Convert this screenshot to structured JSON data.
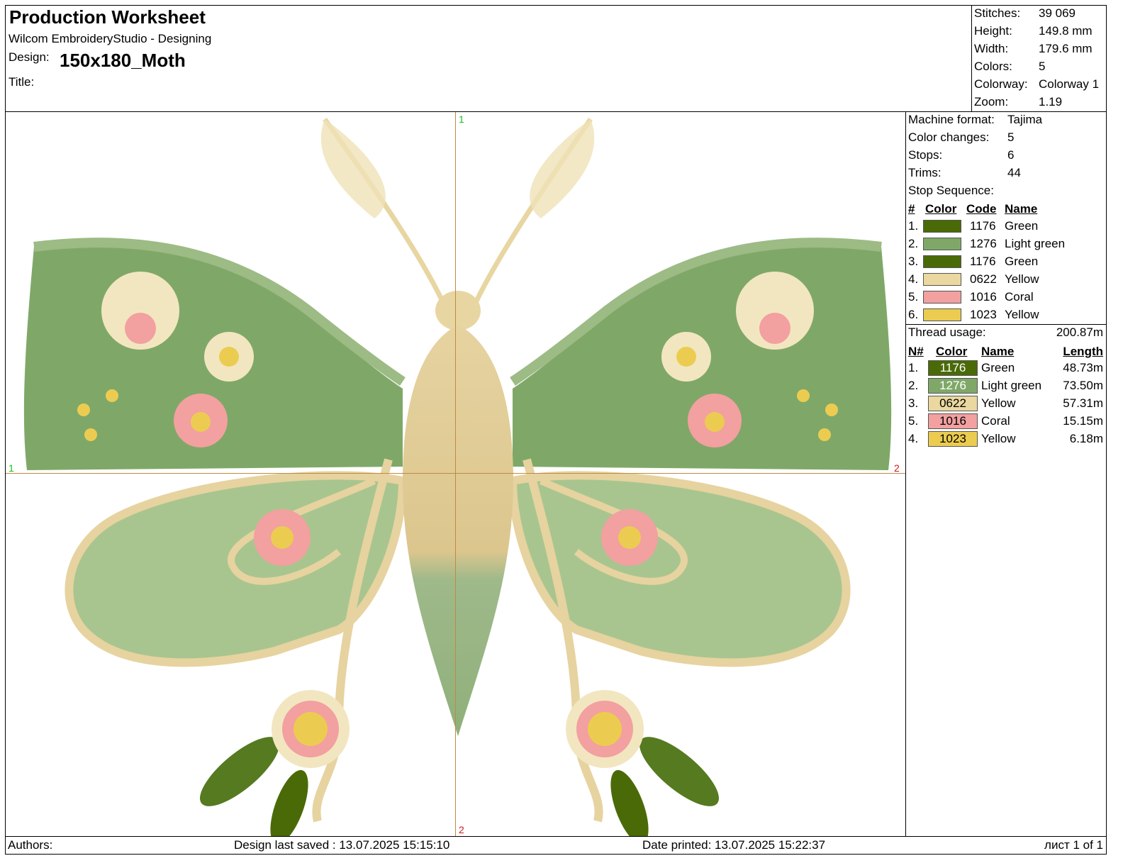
{
  "header": {
    "title": "Production Worksheet",
    "app": "Wilcom EmbroideryStudio - Designing",
    "design_label": "Design:",
    "design_name": "150x180_Moth",
    "title_label": "Title:"
  },
  "stats": [
    {
      "label": "Stitches:",
      "value": "39 069"
    },
    {
      "label": "Height:",
      "value": "149.8 mm"
    },
    {
      "label": "Width:",
      "value": "179.6 mm"
    },
    {
      "label": "Colors:",
      "value": "5"
    },
    {
      "label": "Colorway:",
      "value": "Colorway 1"
    },
    {
      "label": "Zoom:",
      "value": "1.19"
    }
  ],
  "machine": [
    {
      "label": "Machine format:",
      "value": "Tajima"
    },
    {
      "label": "Color changes:",
      "value": "5"
    },
    {
      "label": "Stops:",
      "value": "6"
    },
    {
      "label": "Trims:",
      "value": "44"
    }
  ],
  "stop_sequence": {
    "label": "Stop Sequence:",
    "headers": {
      "num": "#",
      "color": "Color",
      "code": "Code",
      "name": "Name"
    },
    "rows": [
      {
        "num": "1.",
        "color": "#4a6a08",
        "code": "1176",
        "name": "Green"
      },
      {
        "num": "2.",
        "color": "#7fa868",
        "code": "1276",
        "name": "Light green"
      },
      {
        "num": "3.",
        "color": "#4a6a08",
        "code": "1176",
        "name": "Green"
      },
      {
        "num": "4.",
        "color": "#ead8a0",
        "code": "0622",
        "name": "Yellow"
      },
      {
        "num": "5.",
        "color": "#f2a0a0",
        "code": "1016",
        "name": "Coral"
      },
      {
        "num": "6.",
        "color": "#eccc50",
        "code": "1023",
        "name": "Yellow"
      }
    ]
  },
  "thread_usage": {
    "label": "Thread usage:",
    "total": "200.87m",
    "headers": {
      "num": "N#",
      "color": "Color",
      "name": "Name",
      "length": "Length"
    },
    "rows": [
      {
        "num": "1.",
        "color": "#4a6a08",
        "code": "1176",
        "name": "Green",
        "length": "48.73m",
        "light": false
      },
      {
        "num": "2.",
        "color": "#7fa868",
        "code": "1276",
        "name": "Light green",
        "length": "73.50m",
        "light": false
      },
      {
        "num": "3.",
        "color": "#ead8a0",
        "code": "0622",
        "name": "Yellow",
        "length": "57.31m",
        "light": true
      },
      {
        "num": "5.",
        "color": "#f2a0a0",
        "code": "1016",
        "name": "Coral",
        "length": "15.15m",
        "light": true
      },
      {
        "num": "4.",
        "color": "#eccc50",
        "code": "1023",
        "name": "Yellow",
        "length": "6.18m",
        "light": true
      }
    ]
  },
  "markers": {
    "top": "1",
    "left": "1",
    "right": "2",
    "bottom": "2"
  },
  "footer": {
    "authors": "Authors:",
    "saved": "Design last saved : 13.07.2025 15:15:10",
    "printed": "Date printed: 13.07.2025 15:22:37",
    "page": "лист 1 of 1"
  }
}
